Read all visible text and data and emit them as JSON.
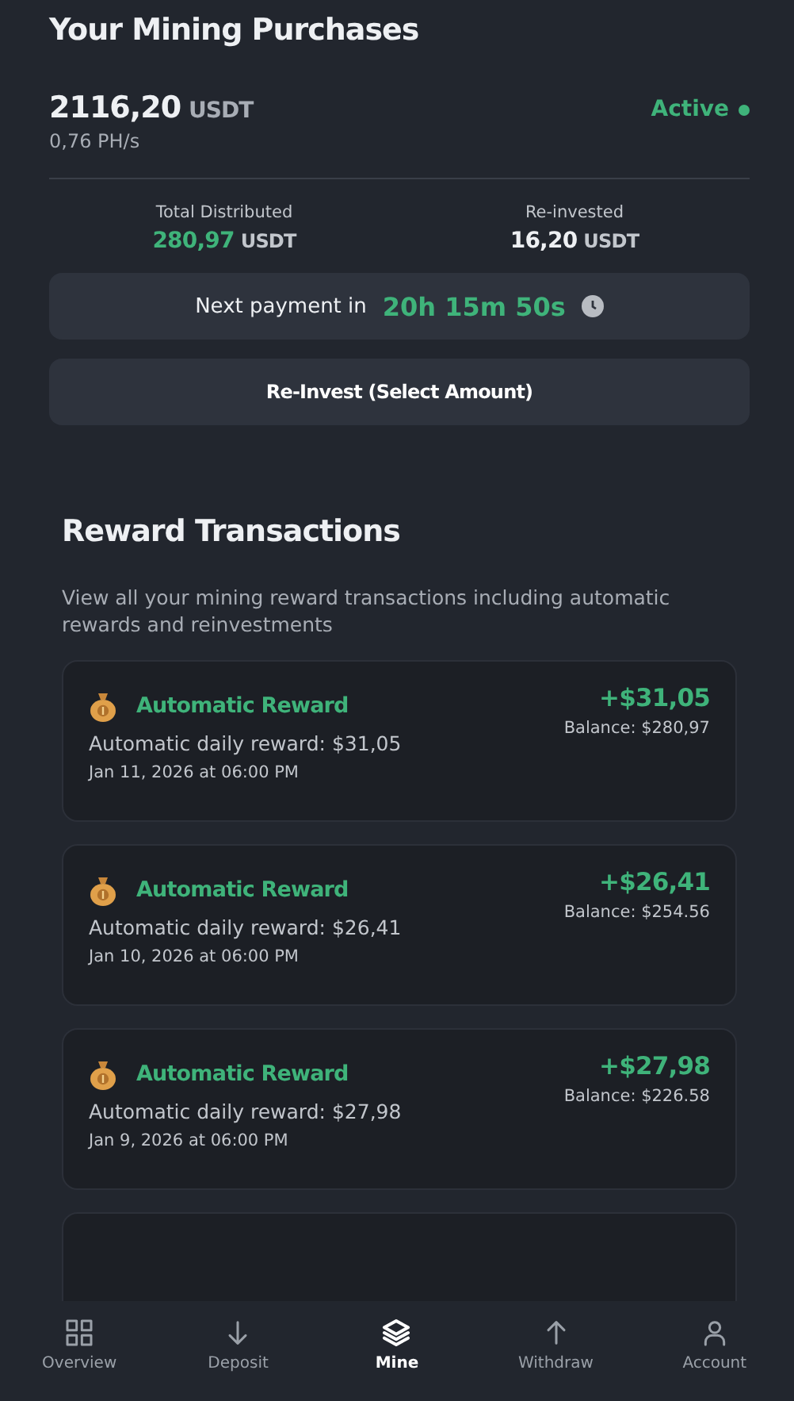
{
  "purchases": {
    "title": "Your Mining Purchases",
    "amount": "2116,20",
    "amount_unit": "USDT",
    "hashrate": "0,76 PH/s",
    "status": "Active",
    "active": true,
    "stats": [
      {
        "label": "Total Distributed",
        "value": "280,97",
        "unit": "USDT",
        "kind": "positive"
      },
      {
        "label": "Re-invested",
        "value": "16,20",
        "unit": "USDT",
        "kind": "neutral"
      }
    ],
    "next_payment": {
      "label": "Next payment in",
      "countdown": "20h 15m 50s"
    },
    "reinvest_button": "Re-Invest (Select Amount)"
  },
  "rewards": {
    "title": "Reward Transactions",
    "description": "View all your mining reward transactions including automatic rewards and reinvestments",
    "transactions": [
      {
        "title": "Automatic Reward",
        "description": "Automatic daily reward: $31,05",
        "date": "Jan 11, 2026 at 06:00 PM",
        "amount": "+$31,05",
        "balance": "Balance: $280,97"
      },
      {
        "title": "Automatic Reward",
        "description": "Automatic daily reward: $26,41",
        "date": "Jan 10, 2026 at 06:00 PM",
        "amount": "+$26,41",
        "balance": "Balance: $254.56"
      },
      {
        "title": "Automatic Reward",
        "description": "Automatic daily reward: $27,98",
        "date": "Jan 9, 2026 at 06:00 PM",
        "amount": "+$27,98",
        "balance": "Balance: $226.58"
      }
    ]
  },
  "nav": [
    {
      "label": "Overview",
      "selected": false
    },
    {
      "label": "Deposit",
      "selected": false
    },
    {
      "label": "Mine",
      "selected": true
    },
    {
      "label": "Withdraw",
      "selected": false
    },
    {
      "label": "Account",
      "selected": false
    }
  ]
}
